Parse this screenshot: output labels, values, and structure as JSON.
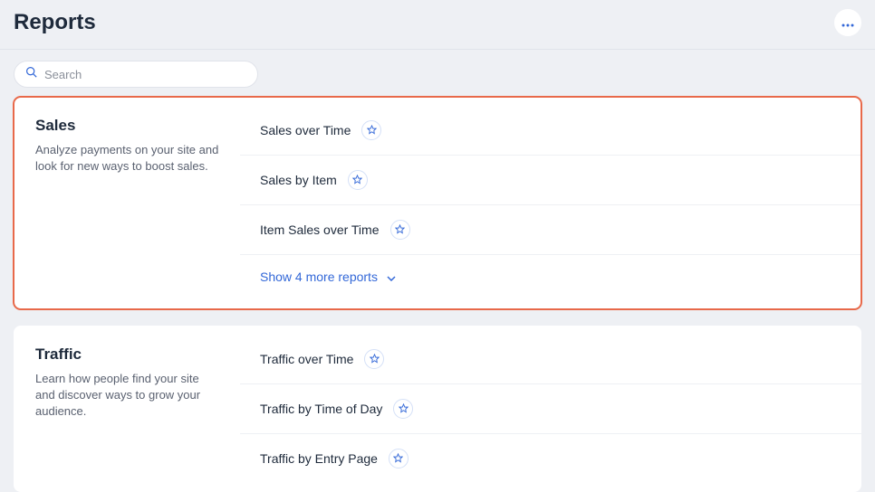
{
  "header": {
    "title": "Reports"
  },
  "search": {
    "placeholder": "Search",
    "value": ""
  },
  "sections": [
    {
      "title": "Sales",
      "description": "Analyze payments on your site and look for new ways to boost sales.",
      "highlighted": true,
      "reports": [
        {
          "name": "Sales over Time"
        },
        {
          "name": "Sales by Item"
        },
        {
          "name": "Item Sales over Time"
        }
      ],
      "show_more_label": "Show 4 more reports"
    },
    {
      "title": "Traffic",
      "description": "Learn how people find your site and discover ways to grow your audience.",
      "highlighted": false,
      "reports": [
        {
          "name": "Traffic over Time"
        },
        {
          "name": "Traffic by Time of Day"
        },
        {
          "name": "Traffic by Entry Page"
        }
      ],
      "show_more_label": ""
    }
  ]
}
